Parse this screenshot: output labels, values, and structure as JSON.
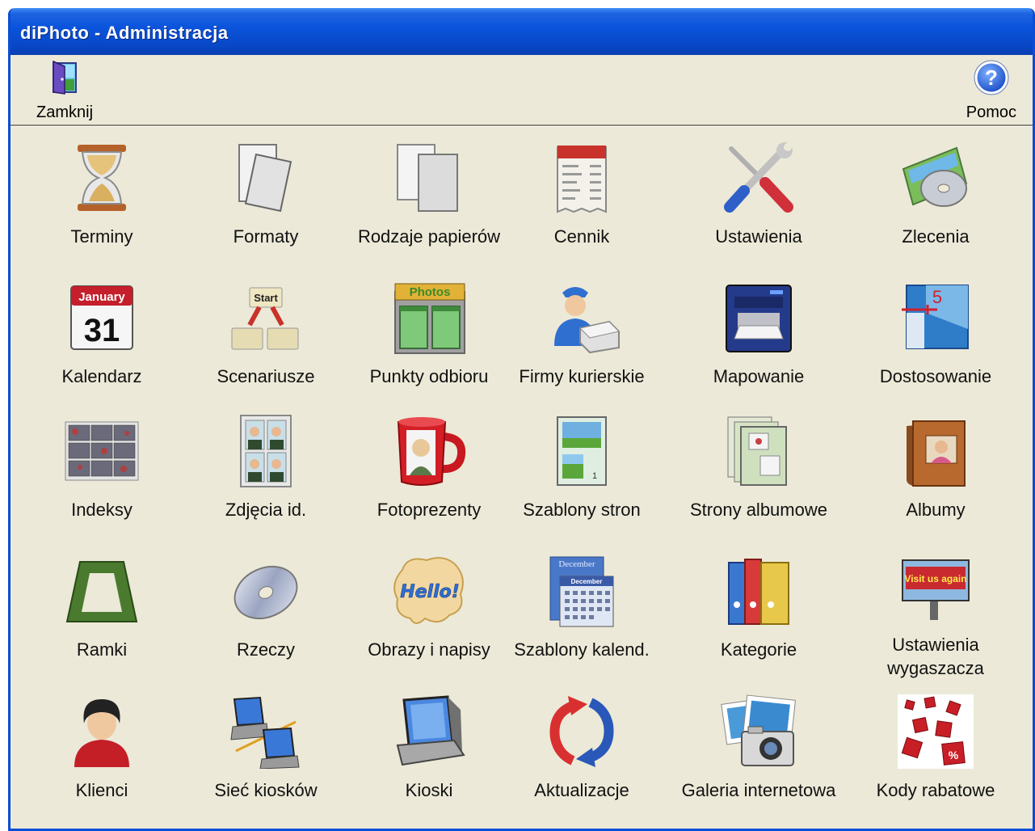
{
  "window": {
    "title": "diPhoto - Administracja"
  },
  "toolbar": {
    "close_label": "Zamknij",
    "help_label": "Pomoc"
  },
  "items": [
    {
      "label": "Terminy",
      "icon": "hourglass-icon"
    },
    {
      "label": "Formaty",
      "icon": "photo-formats-icon"
    },
    {
      "label": "Rodzaje papierów",
      "icon": "paper-types-icon"
    },
    {
      "label": "Cennik",
      "icon": "pricelist-icon"
    },
    {
      "label": "Ustawienia",
      "icon": "tools-icon"
    },
    {
      "label": "Zlecenia",
      "icon": "orders-disc-icon"
    },
    {
      "label": "Kalendarz",
      "icon": "calendar-icon",
      "month": "January",
      "day": "31"
    },
    {
      "label": "Scenariusze",
      "icon": "scenario-flow-icon",
      "start": "Start"
    },
    {
      "label": "Punkty odbioru",
      "icon": "photo-shop-icon",
      "sign": "Photos"
    },
    {
      "label": "Firmy kurierskie",
      "icon": "courier-icon"
    },
    {
      "label": "Mapowanie",
      "icon": "printer-icon"
    },
    {
      "label": "Dostosowanie",
      "icon": "adjust-icon",
      "mark": "5"
    },
    {
      "label": "Indeksy",
      "icon": "index-print-icon"
    },
    {
      "label": "Zdjęcia id.",
      "icon": "id-photos-icon"
    },
    {
      "label": "Fotoprezenty",
      "icon": "photo-mug-icon"
    },
    {
      "label": "Szablony stron",
      "icon": "page-template-icon",
      "mark": "1"
    },
    {
      "label": "Strony albumowe",
      "icon": "album-pages-icon"
    },
    {
      "label": "Albumy",
      "icon": "album-book-icon"
    },
    {
      "label": "Ramki",
      "icon": "frame-icon"
    },
    {
      "label": "Rzeczy",
      "icon": "cd-disc-icon"
    },
    {
      "label": "Obrazy i napisy",
      "icon": "hello-bubble-icon",
      "text": "Hello!"
    },
    {
      "label": "Szablony kalend.",
      "icon": "calendar-template-icon",
      "month": "December"
    },
    {
      "label": "Kategorie",
      "icon": "binders-icon"
    },
    {
      "label": "Ustawienia wygaszacza",
      "icon": "billboard-icon",
      "text": "Visit us again"
    },
    {
      "label": "Klienci",
      "icon": "client-person-icon"
    },
    {
      "label": "Sieć kiosków",
      "icon": "kiosk-network-icon"
    },
    {
      "label": "Kioski",
      "icon": "kiosk-icon"
    },
    {
      "label": "Aktualizacje",
      "icon": "refresh-arrows-icon"
    },
    {
      "label": "Galeria internetowa",
      "icon": "camera-gallery-icon"
    },
    {
      "label": "Kody rabatowe",
      "icon": "discount-dice-icon",
      "text": "%"
    }
  ],
  "colors": {
    "titlebar": "#0b54dc",
    "background": "#ece9d8",
    "border": "#0a4dd6"
  }
}
